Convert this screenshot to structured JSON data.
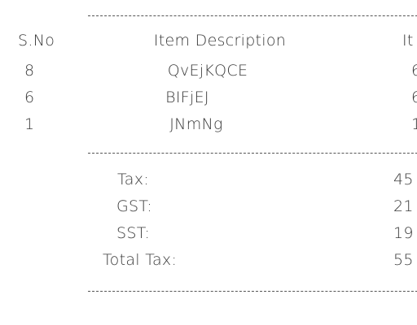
{
  "separator": "------------------------------------------------",
  "header": {
    "sno": "S.No",
    "description": "Item Description",
    "third_col": "It"
  },
  "items": [
    {
      "sno": "8",
      "description": "QvEjKQCE",
      "third": "6"
    },
    {
      "sno": "6",
      "description": "BIFjEJ",
      "third": "6"
    },
    {
      "sno": "1",
      "description": "JNmNg",
      "third": "1"
    }
  ],
  "taxes": [
    {
      "label": "Tax:",
      "value": "45"
    },
    {
      "label": "GST:",
      "value": "21"
    },
    {
      "label": "SST:",
      "value": "19"
    },
    {
      "label": "Total Tax:",
      "value": "55"
    }
  ]
}
